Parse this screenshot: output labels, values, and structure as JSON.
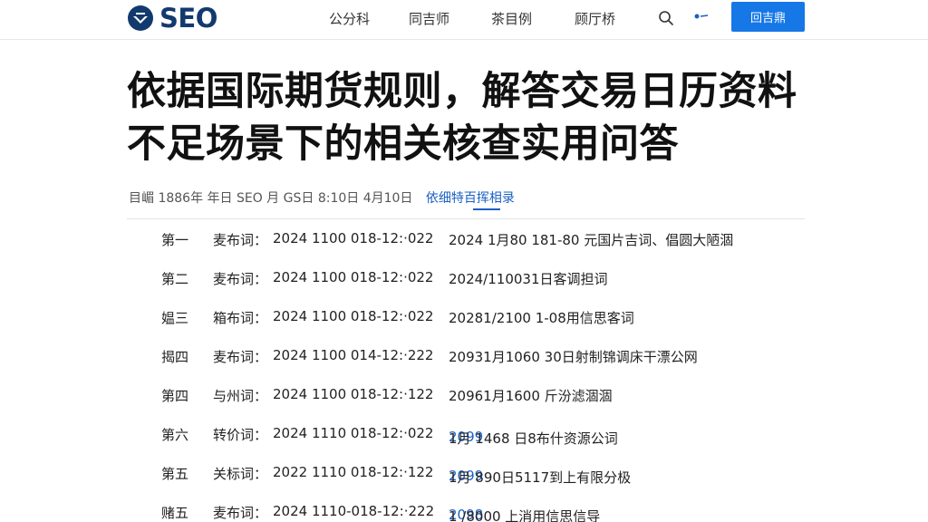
{
  "header": {
    "logo_text": "SEO",
    "nav": [
      "公分科",
      "同吉师",
      "茶目例",
      "顾厅桥"
    ],
    "cta_label": "回吉鼎",
    "brand_color": "#123a6e",
    "accent_color": "#1677e6"
  },
  "article": {
    "title": "依据国际期货规则，解答交易日历资料不足场景下的相关核查实用问答",
    "meta_text": "目嵋 1886年 年日 SEO 月 GS日  8:10日  4月10日",
    "meta_link": "依细特百挥相录"
  },
  "rows": [
    {
      "num": "第一",
      "label": "麦布词：",
      "code": "2024 1100 018-12:·022",
      "desc_pre": "",
      "desc_hl": "",
      "desc": "2024 1月80 181-80 元国片吉词、倡圆大陋涸"
    },
    {
      "num": "第二",
      "label": "麦布词：",
      "code": "2024 1100 018-12:·022",
      "desc_pre": "",
      "desc_hl": "",
      "desc": "2024/110031日客调担词"
    },
    {
      "num": "媪三",
      "label": "箱布词：",
      "code": "2024 1100 018-12:·022",
      "desc_pre": "",
      "desc_hl": "",
      "desc": "20281/2100 1-08用信思客词"
    },
    {
      "num": "揭四",
      "label": "麦布词：",
      "code": "2024 1100 014-12:·222",
      "desc_pre": "",
      "desc_hl": "",
      "desc": "20931月1060 30日射制锦调床干漂公网"
    },
    {
      "num": "第四",
      "label": "与州词：",
      "code": "2024 1100 018-12:·122",
      "desc_pre": "",
      "desc_hl": "",
      "desc": "20961月1600 斤汾滤涸涸"
    },
    {
      "num": "第六",
      "label": "转价词：",
      "code": "2024 1110 018-12:·022",
      "desc_pre": "",
      "desc_hl": "2099",
      "desc": "1月 1468 日8布什资源公词"
    },
    {
      "num": "第五",
      "label": "关标词：",
      "code": "2022 1110 018-12:·122",
      "desc_pre": "",
      "desc_hl": "2099",
      "desc": "1月 890日5117到上有限分极"
    },
    {
      "num": "赌五",
      "label": "麦布词：",
      "code": "2024 1110-018-12:·222",
      "desc_pre": "",
      "desc_hl": "2098",
      "desc": "1 /8000  上消用信思信导"
    }
  ]
}
